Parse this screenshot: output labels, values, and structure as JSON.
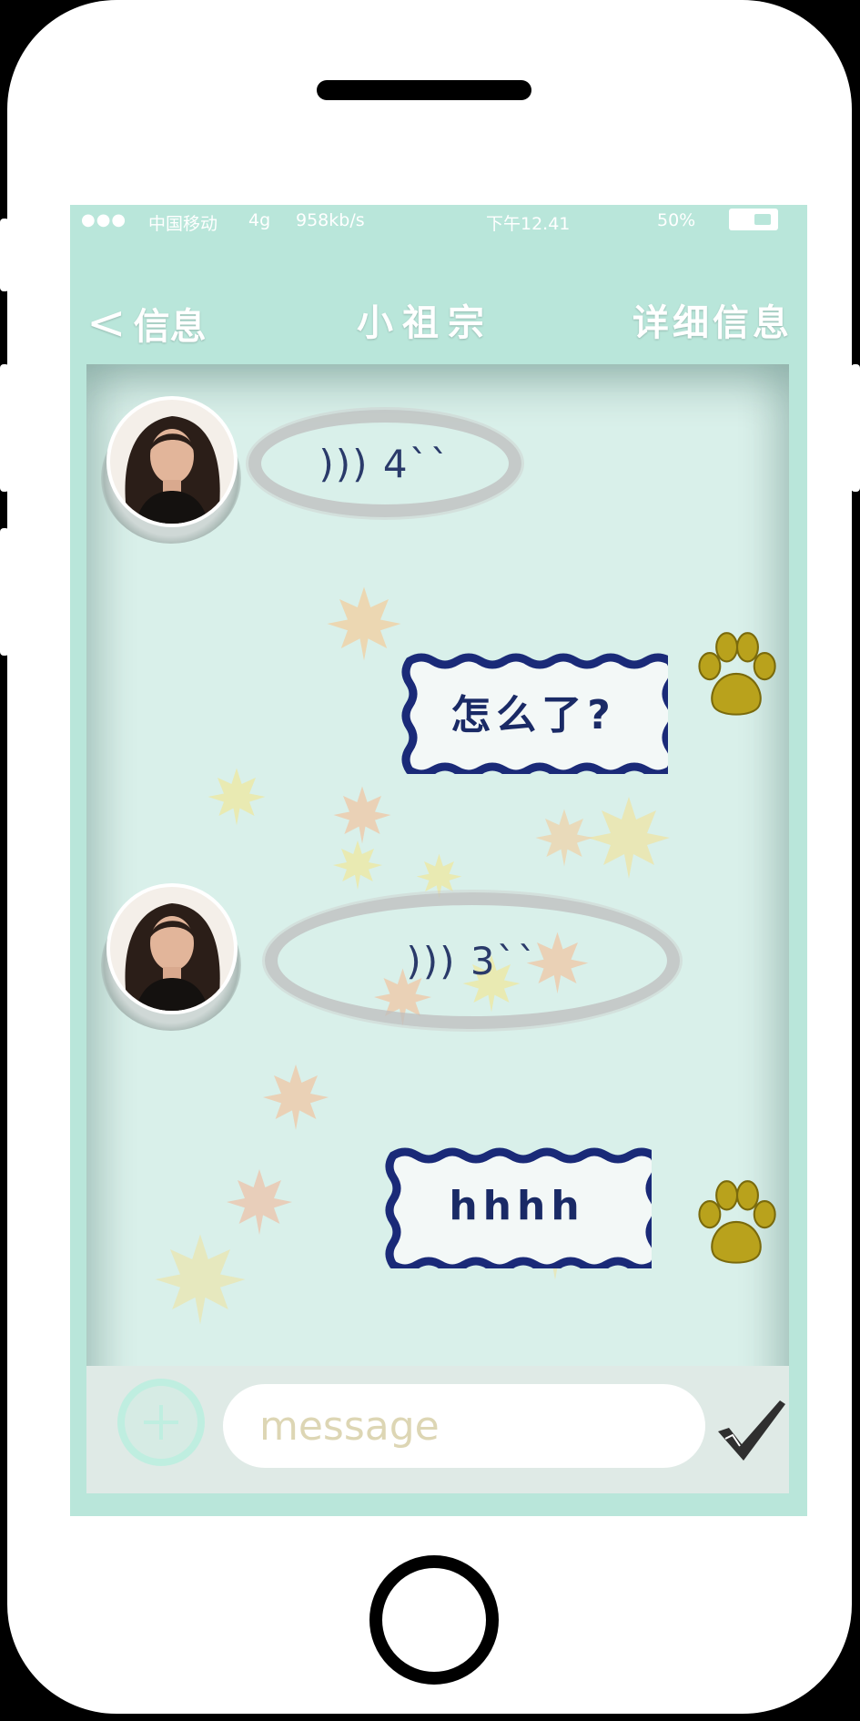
{
  "status_bar": {
    "signal_dots": "●●●",
    "carrier": "中国移动",
    "network": "4g",
    "speed": "958kb/s",
    "time": "下午12.41",
    "battery": "50%"
  },
  "nav": {
    "back_label": "信息",
    "title": "小祖宗",
    "detail_label": "详细信息"
  },
  "messages": [
    {
      "side": "left",
      "text": "))) 4``"
    },
    {
      "side": "right",
      "text": "怎么了?"
    },
    {
      "side": "left",
      "text": "))) 3``"
    },
    {
      "side": "right",
      "text": "hhhh"
    }
  ],
  "composer": {
    "placeholder": "message"
  },
  "colors": {
    "screen_bg": "#b9e6da",
    "chat_bg": "#d9f0ea",
    "bubble_border_right": "#1a2a78",
    "paw": "#b9a21c"
  },
  "icons": {
    "back": "chevron-left-icon",
    "add": "plus-circle-icon",
    "send": "checkmark-icon",
    "paw": "paw-icon"
  }
}
